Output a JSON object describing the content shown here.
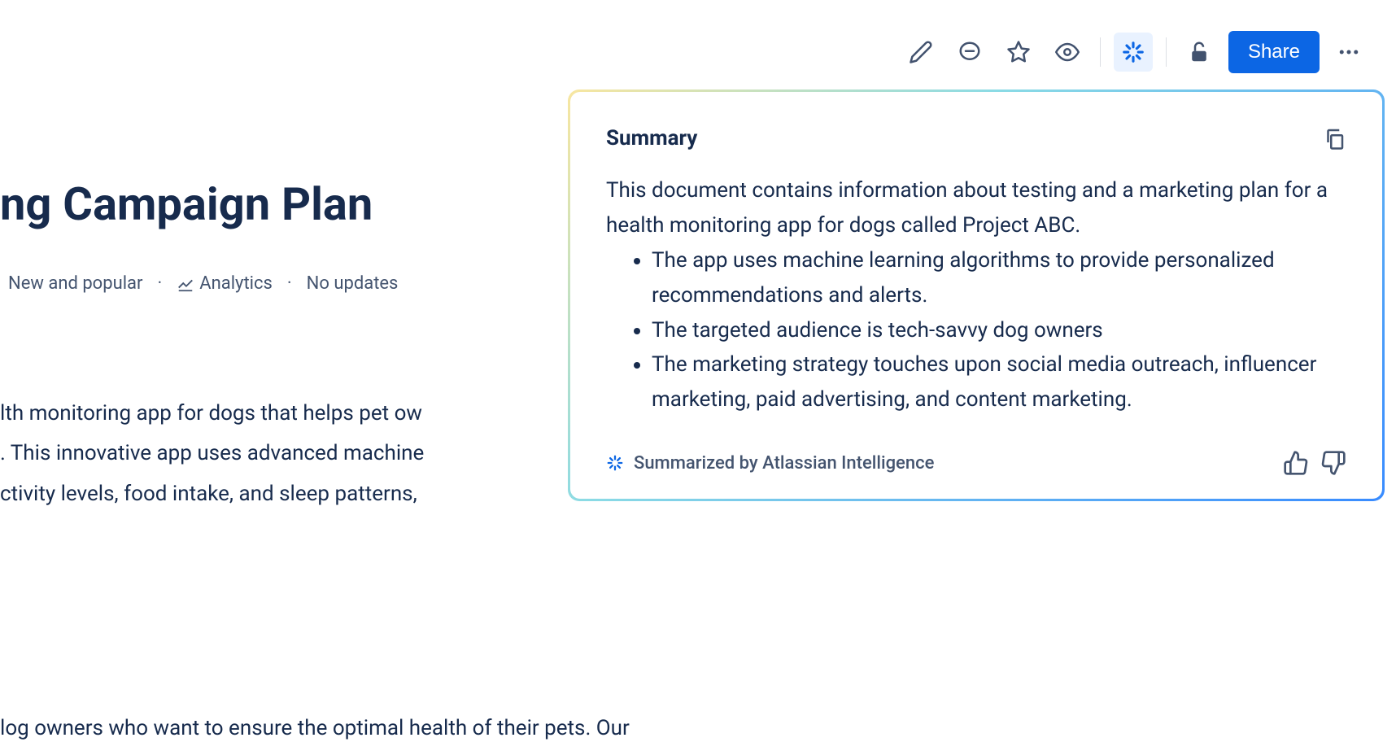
{
  "toolbar": {
    "share_label": "Share"
  },
  "page": {
    "title_fragment": "ng Campaign Plan"
  },
  "meta": {
    "new_popular": "New and popular",
    "analytics": "Analytics",
    "updates": "No updates"
  },
  "body": {
    "line1": "lth monitoring app for dogs that helps pet ow",
    "line2": ". This innovative app uses advanced machine ",
    "line3": "ctivity levels, food intake, and sleep patterns,",
    "line4": "log owners who want to ensure the optimal health of their pets. Our"
  },
  "summary": {
    "title": "Summary",
    "intro": "This document contains information about testing and a marketing plan for a health monitoring app for dogs called Project ABC.",
    "bullets": [
      "The app uses machine learning algorithms to provide personalized recommendations and alerts.",
      "The targeted audience is tech-savvy dog owners",
      "The marketing strategy touches upon social media outreach, influencer marketing, paid advertising, and content marketing."
    ],
    "attribution": "Summarized by Atlassian Intelligence"
  }
}
